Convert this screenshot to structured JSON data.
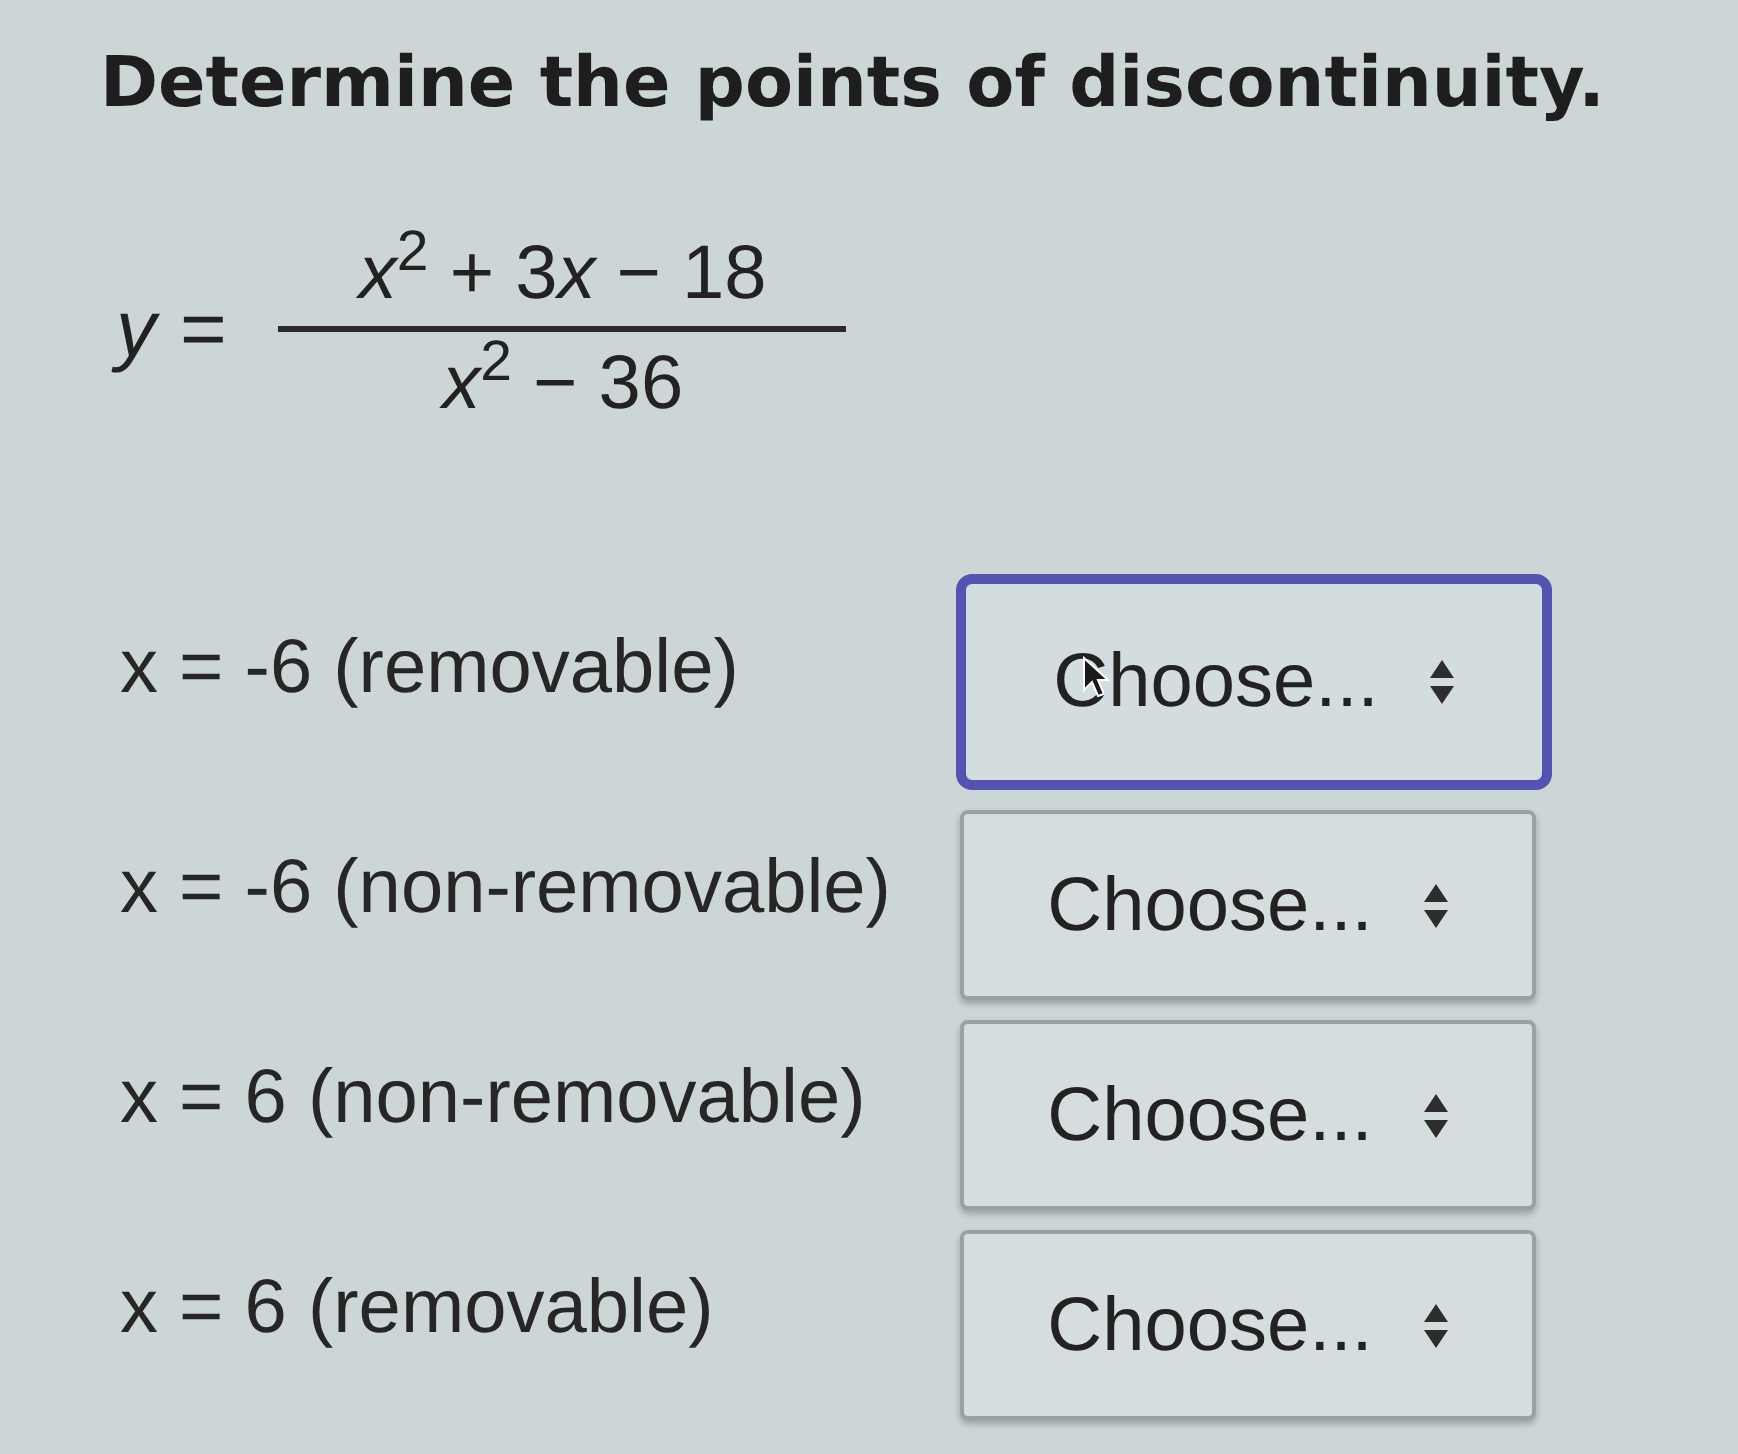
{
  "prompt": {
    "title": "Determine the points of discontinuity."
  },
  "equation": {
    "lhs": "y",
    "operator": "=",
    "numerator": [
      "*x*$^{2}$ + 3",
      "*x* − 18"
    ],
    "denominator": "*x*$^{2}$ − 36"
  },
  "items": [
    {
      "label": "x = -6 (removable)",
      "select": {
        "value": "Choose...",
        "focused": true,
        "hovered": true
      }
    },
    {
      "label": "x = -6 (non-removable)",
      "select": {
        "value": "Choose...",
        "focused": false,
        "hovered": false
      }
    },
    {
      "label": "x = 6 (non-removable)",
      "select": {
        "value": "Choose...",
        "focused": false,
        "hovered": false
      }
    },
    {
      "label": "x = 6 (removable)",
      "select": {
        "value": "Choose...",
        "focused": false,
        "hovered": false
      }
    }
  ]
}
